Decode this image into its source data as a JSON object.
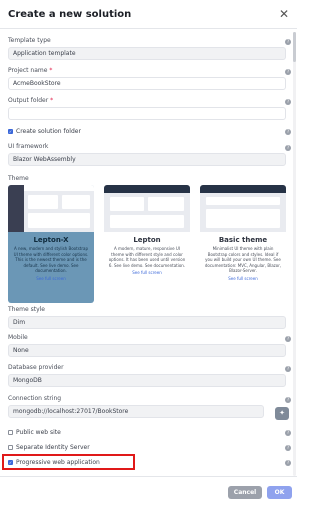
{
  "dialog": {
    "title": "Create a new solution"
  },
  "fields": {
    "template_type": {
      "label": "Template type",
      "value": "Application template"
    },
    "project_name": {
      "label": "Project name",
      "value": "AcmeBookStore"
    },
    "output_folder": {
      "label": "Output folder",
      "value": ""
    },
    "create_solution_folder": {
      "label": "Create solution folder",
      "checked": true
    },
    "ui_framework": {
      "label": "UI framework",
      "value": "Blazor WebAssembly"
    },
    "theme": {
      "label": "Theme"
    },
    "theme_style": {
      "label": "Theme style",
      "value": "Dim"
    },
    "mobile": {
      "label": "Mobile",
      "value": "None"
    },
    "database_provider": {
      "label": "Database provider",
      "value": "MongoDB"
    },
    "connection_string": {
      "label": "Connection string",
      "value": "mongodb://localhost:27017/BookStore"
    },
    "public_web_site": {
      "label": "Public web site",
      "checked": false
    },
    "separate_identity_server": {
      "label": "Separate Identity Server",
      "checked": false
    },
    "progressive_web_application": {
      "label": "Progressive web application",
      "checked": true
    }
  },
  "themes": [
    {
      "name": "Lepton-X",
      "desc": "A new, modern and stylish Bootstrap UI theme with different color options. This is the newest theme and is the default. See live demo. See documentation.",
      "link": "See full screen",
      "selected": true
    },
    {
      "name": "Lepton",
      "desc": "A modern, mature, responsive UI theme with different style and color options. It has been used until version 6. See live demo. See documentation.",
      "link": "See full screen",
      "selected": false
    },
    {
      "name": "Basic theme",
      "desc": "Minimalist UI theme with plain Bootstrap colors and styles. Ideal if you will build your own UI theme. See documentation: MVC, Angular, Blazor, Blazor-Server.",
      "link": "See full screen",
      "selected": false
    }
  ],
  "buttons": {
    "cancel": "Cancel",
    "ok": "OK"
  },
  "colors": {
    "accent": "#3a67d9",
    "selected_theme": "#6b97b6",
    "highlight": "#e01919"
  }
}
